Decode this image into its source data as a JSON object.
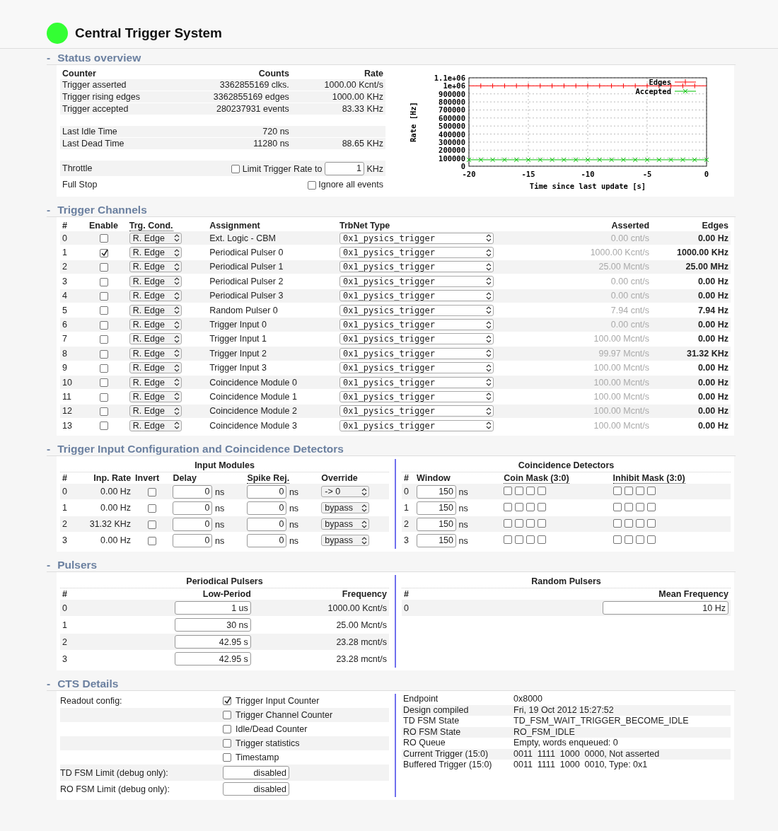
{
  "header": {
    "title": "Central Trigger System",
    "color": "#33ff33"
  },
  "status_overview": {
    "toggle": "-",
    "title": "Status overview",
    "columns": [
      "Counter",
      "Counts",
      "Rate"
    ],
    "groups": [
      [
        {
          "counter": "Trigger asserted",
          "counts": "3362855169 clks.",
          "rate": "1000.00 Kcnt/s"
        },
        {
          "counter": "Trigger rising edges",
          "counts": "3362855169 edges",
          "rate": "1000.00 KHz"
        },
        {
          "counter": "Trigger accepted",
          "counts": "280237931 events",
          "rate": "83.33 KHz"
        }
      ],
      [
        {
          "counter": "Last Idle Time",
          "counts": "720 ns"
        },
        {
          "counter": "Last Dead Time",
          "counts": "11280 ns",
          "rate": "88.65 KHz"
        }
      ]
    ],
    "throttle": {
      "label": "Throttle",
      "checked": false,
      "option": "Limit Trigger Rate to",
      "value": "1",
      "unit": "KHz"
    },
    "full_stop": {
      "label": "Full Stop",
      "checked": false,
      "option": "Ignore all events"
    },
    "chart_data": {
      "type": "line",
      "xlabel": "Time since last update [s]",
      "ylabel": "Rate [Hz]",
      "x": [
        -20,
        -19,
        -18,
        -17,
        -16,
        -15,
        -14,
        -13,
        -12,
        -11,
        -10,
        -9,
        -8,
        -7,
        -6,
        -5,
        -4,
        -3,
        -2,
        -1,
        0
      ],
      "grid": true,
      "legend": "upper right",
      "series": [
        {
          "name": "Edges",
          "color": "#ff0000",
          "marker": "none",
          "errors": [
            null,
            30000,
            30000,
            30000,
            30000,
            30000,
            30000,
            30000,
            30000,
            30000,
            30000,
            30000,
            30000,
            30000,
            30000,
            30000,
            30000,
            30000,
            30000,
            30000,
            null
          ],
          "values": [
            1000000,
            1000000,
            1000000,
            1000000,
            1000000,
            1000000,
            1000000,
            1000000,
            1000000,
            1000000,
            1000000,
            1000000,
            1000000,
            1000000,
            1000000,
            1000000,
            1000000,
            1000000,
            1000000,
            1000000,
            1000000
          ]
        },
        {
          "name": "Accepted",
          "color": "#00c000",
          "marker": "cross",
          "values": [
            80000,
            80000,
            80000,
            80000,
            80000,
            80000,
            80000,
            80000,
            80000,
            80000,
            80000,
            80000,
            80000,
            80000,
            80000,
            80000,
            80000,
            80000,
            80000,
            80000,
            80000
          ]
        }
      ],
      "xlim": [
        -20,
        0
      ],
      "ylim": [
        0,
        1100000
      ],
      "xticks": [
        -20,
        -15,
        -10,
        -5,
        0
      ],
      "yticks": [
        0,
        100000,
        200000,
        300000,
        400000,
        500000,
        600000,
        700000,
        800000,
        900000,
        {
          "value": 1000000,
          "label": "1e+06"
        },
        {
          "value": 1100000,
          "label": "1.1e+06"
        }
      ]
    }
  },
  "trigger_channels": {
    "toggle": "-",
    "title": "Trigger Channels",
    "columns": [
      {
        "label": "#",
        "dotted": false
      },
      {
        "label": "Enable",
        "dotted": false
      },
      {
        "label": "Trg. Cond.",
        "dotted": true
      },
      {
        "label": "Assignment",
        "dotted": false
      },
      {
        "label": "TrbNet Type",
        "dotted": false
      },
      {
        "label": "Asserted",
        "dotted": false
      },
      {
        "label": "Edges",
        "dotted": false
      }
    ],
    "rows": [
      {
        "index": "0",
        "enabled": false,
        "cond": "R. Edge",
        "assignment": "Ext. Logic - CBM",
        "type": "0x1_pysics_trigger",
        "asserted": "0.00 cnt/s",
        "edges": "0.00 Hz"
      },
      {
        "index": "1",
        "enabled": true,
        "cond": "R. Edge",
        "assignment": "Periodical Pulser 0",
        "type": "0x1_pysics_trigger",
        "asserted": "1000.00 Kcnt/s",
        "edges": "1000.00 KHz"
      },
      {
        "index": "2",
        "enabled": false,
        "cond": "R. Edge",
        "assignment": "Periodical Pulser 1",
        "type": "0x1_pysics_trigger",
        "asserted": "25.00 Mcnt/s",
        "edges": "25.00 MHz"
      },
      {
        "index": "3",
        "enabled": false,
        "cond": "R. Edge",
        "assignment": "Periodical Pulser 2",
        "type": "0x1_pysics_trigger",
        "asserted": "0.00 cnt/s",
        "edges": "0.00 Hz"
      },
      {
        "index": "4",
        "enabled": false,
        "cond": "R. Edge",
        "assignment": "Periodical Pulser 3",
        "type": "0x1_pysics_trigger",
        "asserted": "0.00 cnt/s",
        "edges": "0.00 Hz"
      },
      {
        "index": "5",
        "enabled": false,
        "cond": "R. Edge",
        "assignment": "Random Pulser 0",
        "type": "0x1_pysics_trigger",
        "asserted": "7.94 cnt/s",
        "edges": "7.94 Hz"
      },
      {
        "index": "6",
        "enabled": false,
        "cond": "R. Edge",
        "assignment": "Trigger Input 0",
        "type": "0x1_pysics_trigger",
        "asserted": "0.00 cnt/s",
        "edges": "0.00 Hz"
      },
      {
        "index": "7",
        "enabled": false,
        "cond": "R. Edge",
        "assignment": "Trigger Input 1",
        "type": "0x1_pysics_trigger",
        "asserted": "100.00 Mcnt/s",
        "edges": "0.00 Hz"
      },
      {
        "index": "8",
        "enabled": false,
        "cond": "R. Edge",
        "assignment": "Trigger Input 2",
        "type": "0x1_pysics_trigger",
        "asserted": "99.97 Mcnt/s",
        "edges": "31.32 KHz"
      },
      {
        "index": "9",
        "enabled": false,
        "cond": "R. Edge",
        "assignment": "Trigger Input 3",
        "type": "0x1_pysics_trigger",
        "asserted": "100.00 Mcnt/s",
        "edges": "0.00 Hz"
      },
      {
        "index": "10",
        "enabled": false,
        "cond": "R. Edge",
        "assignment": "Coincidence Module 0",
        "type": "0x1_pysics_trigger",
        "asserted": "100.00 Mcnt/s",
        "edges": "0.00 Hz"
      },
      {
        "index": "11",
        "enabled": false,
        "cond": "R. Edge",
        "assignment": "Coincidence Module 1",
        "type": "0x1_pysics_trigger",
        "asserted": "100.00 Mcnt/s",
        "edges": "0.00 Hz"
      },
      {
        "index": "12",
        "enabled": false,
        "cond": "R. Edge",
        "assignment": "Coincidence Module 2",
        "type": "0x1_pysics_trigger",
        "asserted": "100.00 Mcnt/s",
        "edges": "0.00 Hz"
      },
      {
        "index": "13",
        "enabled": false,
        "cond": "R. Edge",
        "assignment": "Coincidence Module 3",
        "type": "0x1_pysics_trigger",
        "asserted": "100.00 Mcnt/s",
        "edges": "0.00 Hz"
      }
    ]
  },
  "input_config": {
    "toggle": "-",
    "title": "Trigger Input Configuration and Coincidence Detectors",
    "input_modules": {
      "title": "Input Modules",
      "columns": [
        {
          "label": "#",
          "dotted": false
        },
        {
          "label": "Inp. Rate",
          "dotted": false
        },
        {
          "label": "Invert",
          "dotted": false
        },
        {
          "label": "Delay",
          "dotted": false
        },
        {
          "label": "Spike Rej.",
          "dotted": true
        },
        {
          "label": "Override",
          "dotted": false
        }
      ],
      "rows": [
        {
          "index": "0",
          "rate": "0.00 Hz",
          "inverted": false,
          "delay": "0",
          "delay_unit": "ns",
          "spike": "0",
          "spike_unit": "ns",
          "override": "-> 0"
        },
        {
          "index": "1",
          "rate": "0.00 Hz",
          "inverted": false,
          "delay": "0",
          "delay_unit": "ns",
          "spike": "0",
          "spike_unit": "ns",
          "override": "bypass"
        },
        {
          "index": "2",
          "rate": "31.32 KHz",
          "inverted": false,
          "delay": "0",
          "delay_unit": "ns",
          "spike": "0",
          "spike_unit": "ns",
          "override": "bypass"
        },
        {
          "index": "3",
          "rate": "0.00 Hz",
          "inverted": false,
          "delay": "0",
          "delay_unit": "ns",
          "spike": "0",
          "spike_unit": "ns",
          "override": "bypass"
        }
      ]
    },
    "coincidence": {
      "title": "Coincidence Detectors",
      "columns": [
        {
          "label": "#",
          "dotted": false
        },
        {
          "label": "Window",
          "dotted": false
        },
        {
          "label": "Coin Mask (3:0)",
          "dotted": true
        },
        {
          "label": "Inhibit Mask (3:0)",
          "dotted": true
        }
      ],
      "rows": [
        {
          "index": "0",
          "window": "150",
          "unit": "ns",
          "coin_mask": [
            false,
            false,
            false,
            false
          ],
          "inhibit_mask": [
            false,
            false,
            false,
            false
          ]
        },
        {
          "index": "1",
          "window": "150",
          "unit": "ns",
          "coin_mask": [
            false,
            false,
            false,
            false
          ],
          "inhibit_mask": [
            false,
            false,
            false,
            false
          ]
        },
        {
          "index": "2",
          "window": "150",
          "unit": "ns",
          "coin_mask": [
            false,
            false,
            false,
            false
          ],
          "inhibit_mask": [
            false,
            false,
            false,
            false
          ]
        },
        {
          "index": "3",
          "window": "150",
          "unit": "ns",
          "coin_mask": [
            false,
            false,
            false,
            false
          ],
          "inhibit_mask": [
            false,
            false,
            false,
            false
          ]
        }
      ]
    }
  },
  "pulsers": {
    "toggle": "-",
    "title": "Pulsers",
    "periodical": {
      "title": "Periodical Pulsers",
      "columns": [
        "#",
        "Low-Period",
        "Frequency"
      ],
      "rows": [
        {
          "index": "0",
          "period": "1 us",
          "frequency": "1000.00 Kcnt/s"
        },
        {
          "index": "1",
          "period": "30 ns",
          "frequency": "25.00 Mcnt/s"
        },
        {
          "index": "2",
          "period": "42.95 s",
          "frequency": "23.28 mcnt/s"
        },
        {
          "index": "3",
          "period": "42.95 s",
          "frequency": "23.28 mcnt/s"
        }
      ]
    },
    "random": {
      "title": "Random Pulsers",
      "columns": [
        "#",
        "Mean Frequency"
      ],
      "rows": [
        {
          "index": "0",
          "frequency": "10 Hz"
        }
      ]
    }
  },
  "cts_details": {
    "toggle": "-",
    "title": "CTS Details",
    "readout": {
      "label": "Readout config:",
      "options": [
        {
          "label": "Trigger Input Counter",
          "checked": true
        },
        {
          "label": "Trigger Channel Counter",
          "checked": false
        },
        {
          "label": "Idle/Dead Counter",
          "checked": false
        },
        {
          "label": "Trigger statistics",
          "checked": false
        },
        {
          "label": "Timestamp",
          "checked": false
        }
      ]
    },
    "limits": [
      {
        "label": "TD FSM Limit (debug only):",
        "value": "disabled"
      },
      {
        "label": "RO FSM Limit (debug only):",
        "value": "disabled"
      }
    ],
    "info": [
      {
        "label": "Endpoint",
        "value": "0x8000"
      },
      {
        "label": "Design compiled",
        "value": "Fri, 19 Oct 2012 15:27:52"
      },
      {
        "label": "TD FSM State",
        "value": "TD_FSM_WAIT_TRIGGER_BECOME_IDLE"
      },
      {
        "label": "RO FSM State",
        "value": "RO_FSM_IDLE"
      },
      {
        "label": "RO Queue",
        "value": "Empty, words enqueued: 0"
      },
      {
        "label": "Current Trigger (15:0)",
        "value": "0011  1111  1000  0000, Not asserted"
      },
      {
        "label": "Buffered Trigger (15:0)",
        "value": "0011  1111  1000  0010, Type: 0x1"
      }
    ]
  }
}
